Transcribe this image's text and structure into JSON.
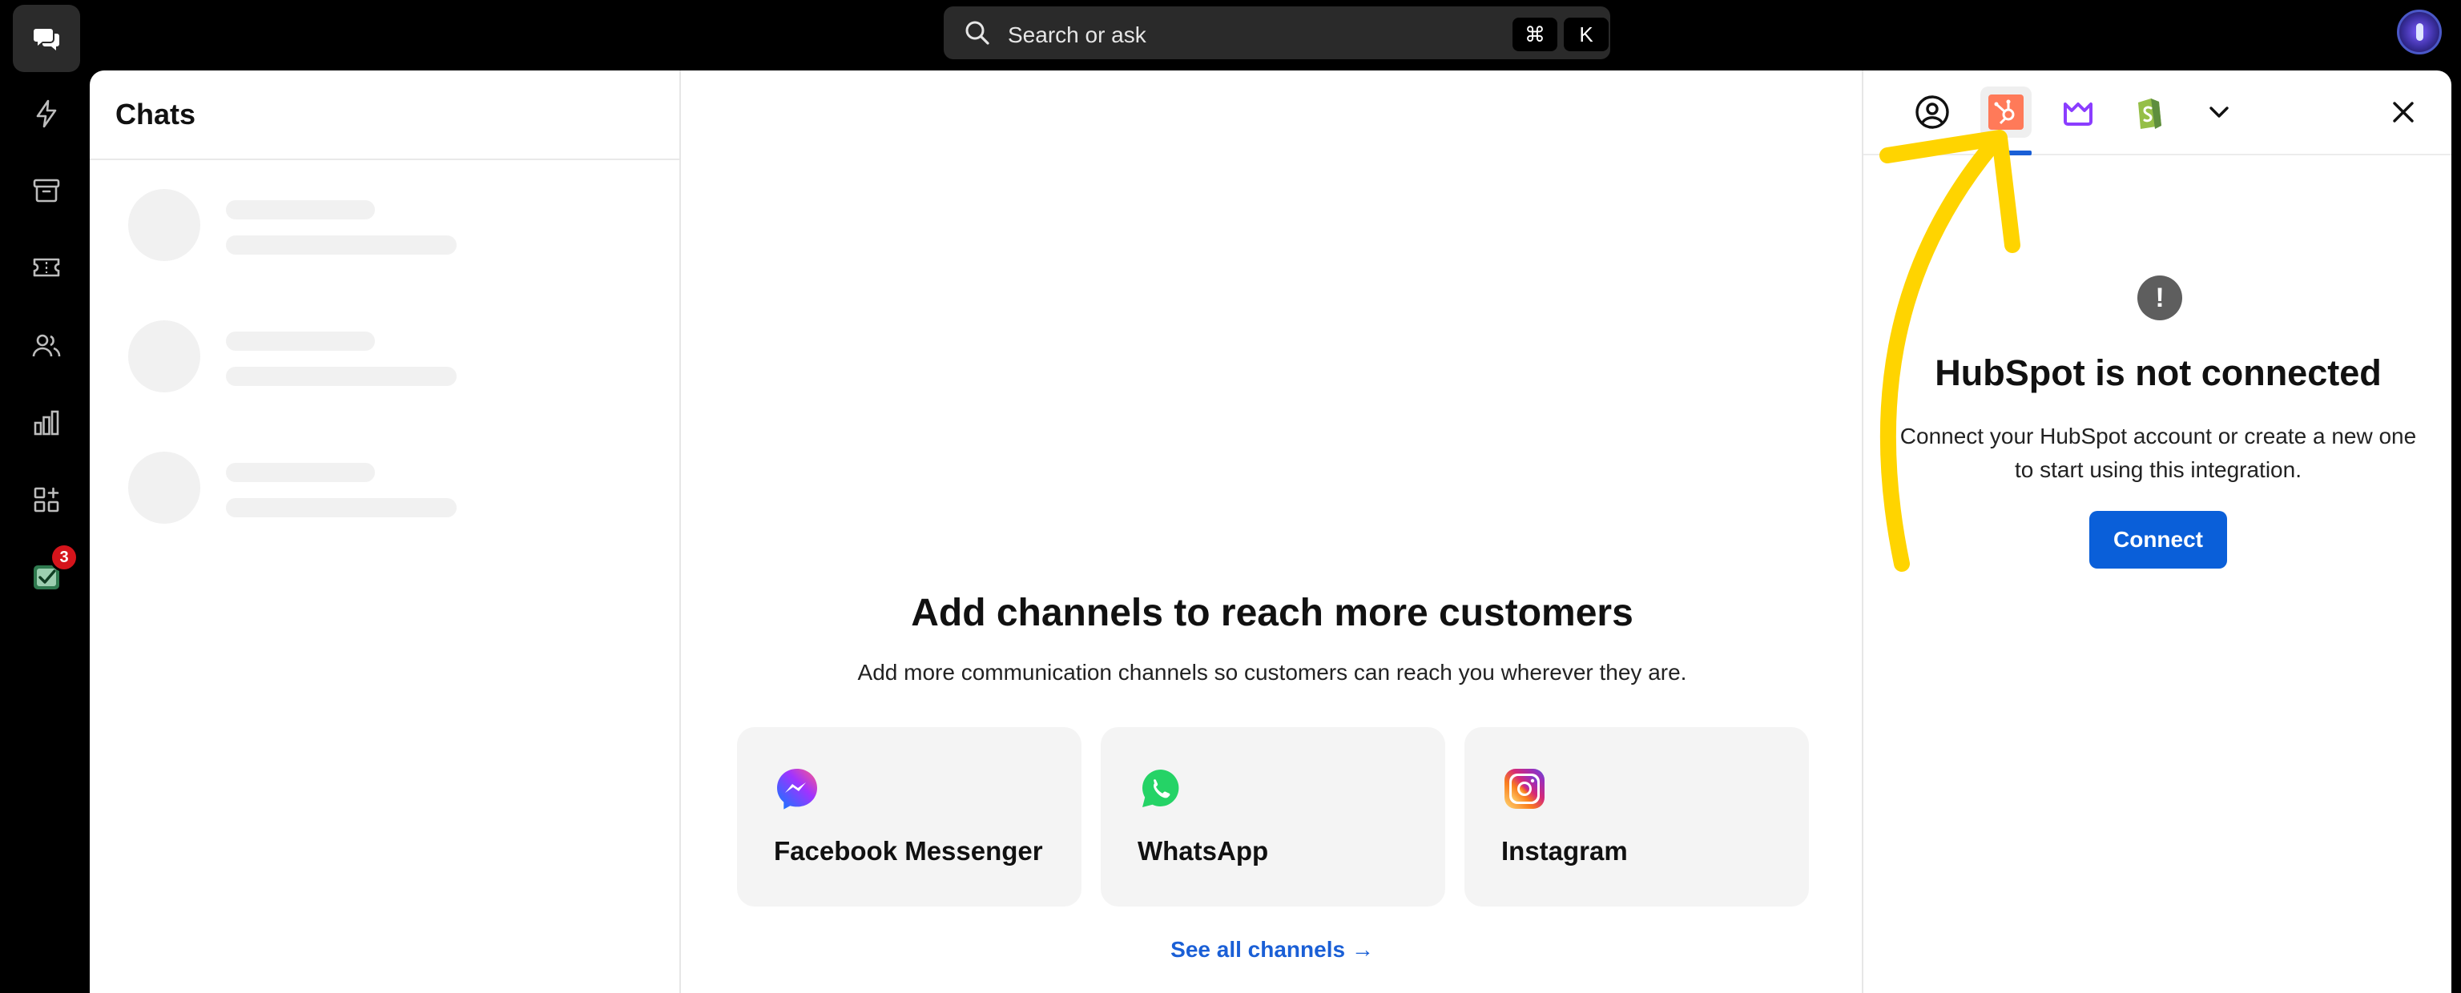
{
  "topbar": {
    "search_placeholder": "Search or ask",
    "shortcut_cmd": "⌘",
    "shortcut_key": "K"
  },
  "rail": {
    "items": [
      {
        "icon": "chat-bubbles-icon",
        "active": true
      },
      {
        "icon": "lightning-icon"
      },
      {
        "icon": "archive-icon"
      },
      {
        "icon": "ticket-icon"
      },
      {
        "icon": "users-icon"
      },
      {
        "icon": "bar-chart-icon"
      },
      {
        "icon": "apps-icon"
      },
      {
        "icon": "checklist-icon",
        "badge": "3"
      }
    ]
  },
  "chats": {
    "title": "Chats"
  },
  "center": {
    "title": "Add channels to reach more customers",
    "subtitle": "Add more communication channels so customers can reach you wherever they are.",
    "channels": [
      {
        "label": "Facebook Messenger",
        "icon": "messenger-icon"
      },
      {
        "label": "WhatsApp",
        "icon": "whatsapp-icon"
      },
      {
        "label": "Instagram",
        "icon": "instagram-icon"
      }
    ],
    "see_all": "See all channels →"
  },
  "right_panel": {
    "tabs": [
      "user-circle-icon",
      "hubspot-icon",
      "mailchimp-icon",
      "shopify-icon",
      "chevron-down-icon"
    ],
    "title": "HubSpot is not connected",
    "text": "Connect your HubSpot account or create a new one to start using this integration.",
    "connect_label": "Connect",
    "warning_symbol": "!"
  },
  "colors": {
    "accent_blue": "#0a5fd9",
    "badge_red": "#d5141b",
    "annotation_yellow": "#ffd400",
    "hubspot_orange": "#ff7a59"
  }
}
